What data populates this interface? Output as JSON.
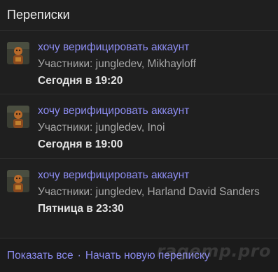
{
  "header": {
    "title": "Переписки"
  },
  "conversations": [
    {
      "title": "хочу верифицировать аккаунт",
      "participants": "Участники: jungledev, Mikhayloff",
      "date": "Сегодня в 19:20",
      "avatar_icon": "user-avatar-icon"
    },
    {
      "title": "хочу верифицировать аккаунт",
      "participants": "Участники: jungledev, Inoi",
      "date": "Сегодня в 19:00",
      "avatar_icon": "user-avatar-icon"
    },
    {
      "title": "хочу верифицировать аккаунт",
      "participants": "Участники: jungledev, Harland David Sanders",
      "date": "Пятница в 23:30",
      "avatar_icon": "user-avatar-icon"
    }
  ],
  "footer": {
    "show_all": "Показать все",
    "separator": "·",
    "new_conversation": "Начать новую переписку"
  },
  "watermark": "ragemp.pro",
  "colors": {
    "background": "#1f1f1f",
    "link": "#8c8cf0",
    "muted_text": "#a7a7a7",
    "strong_text": "#e3e3e3"
  }
}
